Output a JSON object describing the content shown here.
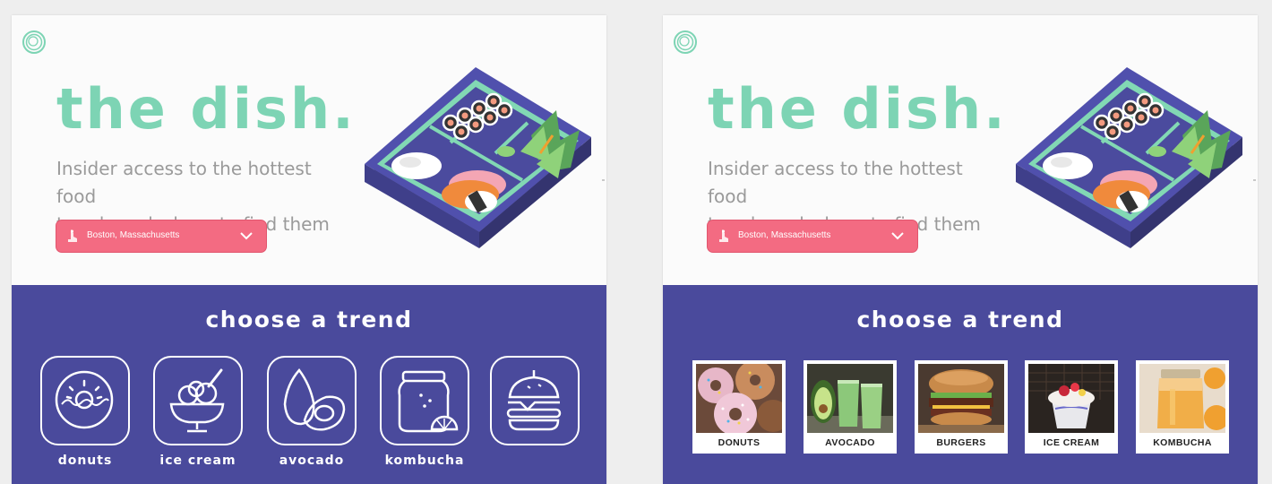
{
  "variants": [
    {
      "title": "the dish.",
      "subtitle_line1": "Insider access to the hottest food",
      "subtitle_line2": "trends and where to find them",
      "location": {
        "label": "Boston, Massachusetts",
        "icon": "location-pin-icon"
      },
      "trend_heading": "choose a trend",
      "trends": [
        {
          "label": "donuts",
          "icon": "donut-icon"
        },
        {
          "label": "ice cream",
          "icon": "ice-cream-bowl-icon"
        },
        {
          "label": "avocado",
          "icon": "avocado-icon"
        },
        {
          "label": "kombucha",
          "icon": "kombucha-jar-icon"
        },
        {
          "label": "",
          "icon": "burger-icon"
        }
      ]
    },
    {
      "title": "the dish.",
      "subtitle_line1": "Insider access to the hottest food",
      "subtitle_line2": "trends and where to find them",
      "location": {
        "label": "Boston, Massachusetts",
        "icon": "location-pin-icon"
      },
      "trend_heading": "choose a trend",
      "trends": [
        {
          "label": "DONUTS",
          "image": "donuts-photo"
        },
        {
          "label": "AVOCADO",
          "image": "avocado-smoothie-photo"
        },
        {
          "label": "BURGERS",
          "image": "burger-photo"
        },
        {
          "label": "ICE CREAM",
          "image": "ice-cream-photo"
        },
        {
          "label": "KOMBUCHA",
          "image": "kombucha-photo"
        }
      ]
    }
  ],
  "colors": {
    "accent_mint": "#7dd4b4",
    "location_pink": "#f36b82",
    "trend_purple": "#4a4a9c",
    "subtitle_gray": "#9a9a9a"
  }
}
